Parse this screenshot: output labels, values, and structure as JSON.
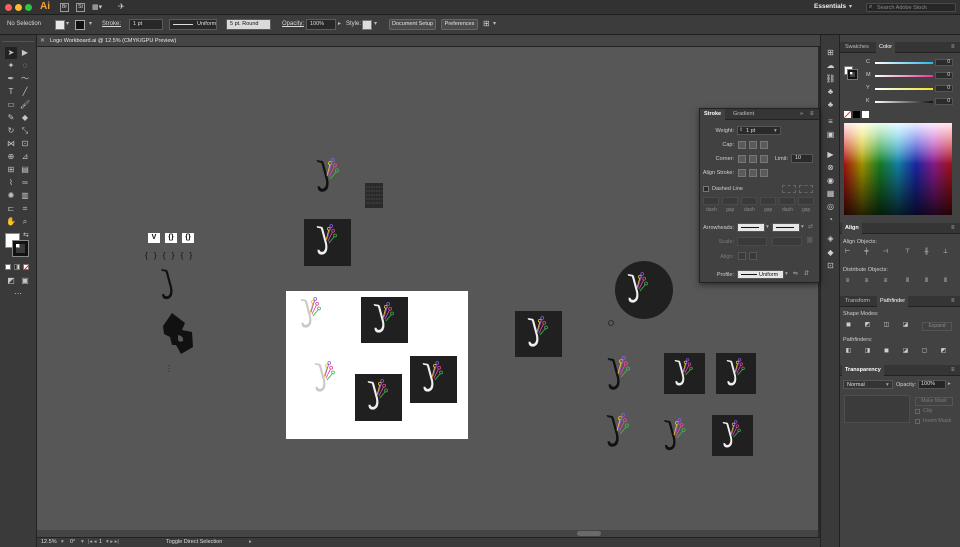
{
  "app": {
    "logo_text": "Ai"
  },
  "titlebar": {
    "bridge_label": "Br",
    "stock_label": "St",
    "workspace": "Essentials",
    "search_placeholder": "Search Adobe Stock"
  },
  "control_bar": {
    "selection_label": "No Selection",
    "stroke_label": "Stroke:",
    "stroke_weight": "1 pt",
    "profile": "Uniform",
    "brush": "5 pt. Round",
    "opacity_label": "Opacity:",
    "opacity_value": "100%",
    "style_label": "Style:",
    "document_setup": "Document Setup",
    "preferences": "Preferences"
  },
  "document": {
    "tab_title": "Logo Workboard.ai @ 12.5% (CMYK/GPU Preview)"
  },
  "status_bar": {
    "zoom": "12.5%",
    "rotation": "0°",
    "artboard": "1",
    "tool_hint": "Toggle Direct Selection"
  },
  "canvas": {
    "glyph_row_1": [
      "V",
      "{}",
      "{}"
    ],
    "glyph_row_2": "{ } { } { }"
  },
  "stroke_panel": {
    "tabs": [
      "Stroke",
      "Gradient"
    ],
    "weight_label": "Weight:",
    "weight_value": "1 pt",
    "cap_label": "Cap:",
    "corner_label": "Corner:",
    "limit_label": "Limit:",
    "limit_value": "10",
    "align_label": "Align Stroke:",
    "dashed_line": "Dashed Line",
    "dash_labels": [
      "dash",
      "gap",
      "dash",
      "gap",
      "dash",
      "gap"
    ],
    "arrowheads_label": "Arrowheads:",
    "scale_label": "Scale:",
    "align2_label": "Align:",
    "profile_label": "Profile:",
    "profile_value": "Uniform"
  },
  "right_panel": {
    "swatches_tab": "Swatches",
    "color_tab": "Color",
    "channels": [
      {
        "label": "C",
        "value": "0",
        "color": "#27b7e8"
      },
      {
        "label": "M",
        "value": "0",
        "color": "#e8339a"
      },
      {
        "label": "Y",
        "value": "0",
        "color": "#efe233"
      },
      {
        "label": "K",
        "value": "0",
        "color": "#9a9a9a"
      }
    ],
    "align_tab": "Align",
    "align_objects": "Align Objects:",
    "distribute_objects": "Distribute Objects:",
    "transform_tab": "Transform",
    "pathfinder_tab": "Pathfinder",
    "shape_modes": "Shape Modes:",
    "expand": "Expand",
    "pathfinders": "Pathfinders:",
    "transparency_tab": "Transparency",
    "blend_mode": "Normal",
    "opacity_label": "Opacity:",
    "opacity_value": "100%",
    "make_mask": "Make Mask",
    "clip": "Clip",
    "invert_mask": "Invert Mask"
  },
  "colors": {
    "canvas_bg": "#575757",
    "panel_bg": "#424242",
    "artboard_bg": "#ffffff",
    "tile_bg": "#202020",
    "accent_yellow": "#f2c230",
    "accent_green": "#39b54a",
    "accent_pink": "#e6449a",
    "accent_purple": "#8c5bd6"
  }
}
